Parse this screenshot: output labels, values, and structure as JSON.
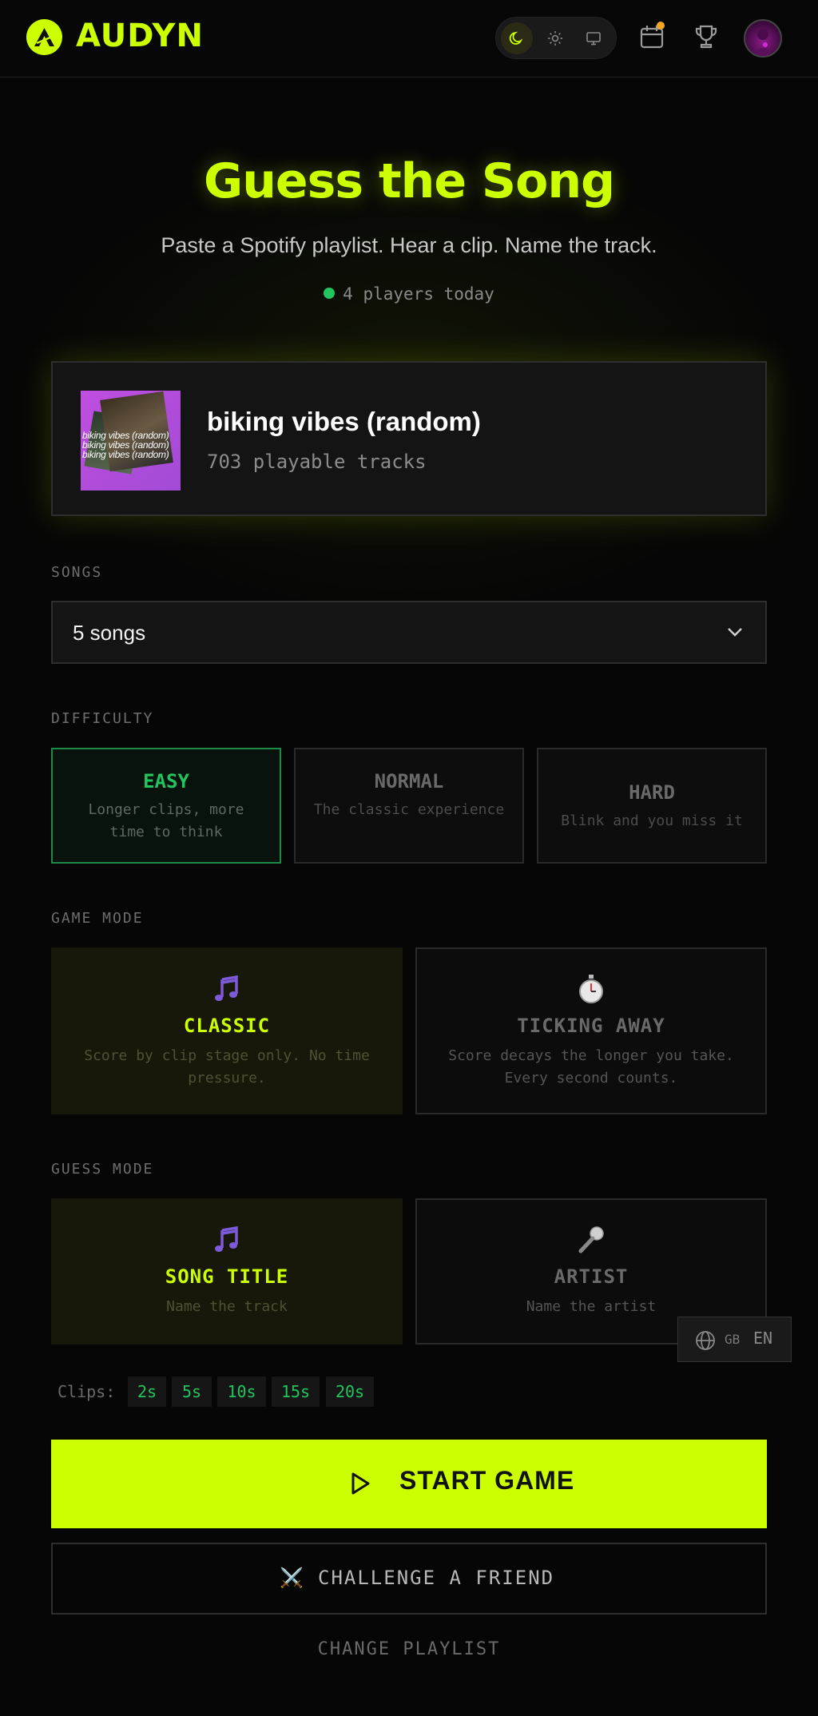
{
  "app": {
    "name": "AUDYN",
    "colors": {
      "accent": "#ccff00",
      "success": "#22c55e",
      "notification": "#f5a623",
      "background": "#060606"
    }
  },
  "header": {
    "theme_options": [
      "dark-mode-icon",
      "light-mode-icon",
      "system-mode-icon"
    ],
    "theme_selected": "dark",
    "icons": [
      "calendar-icon",
      "trophy-icon",
      "avatar"
    ]
  },
  "hero": {
    "title": "Guess the Song",
    "subtitle": "Paste a Spotify playlist. Hear a clip. Name the track.",
    "players_today": "4 players today"
  },
  "playlist": {
    "name": "biking vibes (random)",
    "tracks": "703 playable tracks",
    "cover_text": "biking vibes (random)"
  },
  "songs": {
    "label": "SONGS",
    "value": "5 songs"
  },
  "difficulty": {
    "label": "DIFFICULTY",
    "options": [
      {
        "title": "EASY",
        "desc": "Longer clips, more time to think",
        "selected": true
      },
      {
        "title": "NORMAL",
        "desc": "The classic experience",
        "selected": false
      },
      {
        "title": "HARD",
        "desc": "Blink and you miss it",
        "selected": false
      }
    ]
  },
  "game_mode": {
    "label": "GAME MODE",
    "options": [
      {
        "title": "CLASSIC",
        "desc": "Score by clip stage only. No time pressure.",
        "icon": "music-note-icon",
        "selected": true
      },
      {
        "title": "TICKING AWAY",
        "desc": "Score decays the longer you take. Every second counts.",
        "icon": "stopwatch-icon",
        "selected": false
      }
    ]
  },
  "guess_mode": {
    "label": "GUESS MODE",
    "options": [
      {
        "title": "SONG TITLE",
        "desc": "Name the track",
        "icon": "music-note-icon",
        "selected": true
      },
      {
        "title": "ARTIST",
        "desc": "Name the artist",
        "icon": "microphone-icon",
        "selected": false
      }
    ]
  },
  "language": {
    "code": "GB",
    "label": "EN"
  },
  "clips": {
    "label": "Clips:",
    "values": [
      "2s",
      "5s",
      "10s",
      "15s",
      "20s"
    ]
  },
  "actions": {
    "start": "START GAME",
    "challenge": "CHALLENGE A FRIEND",
    "challenge_icon": "⚔️",
    "change_playlist": "CHANGE PLAYLIST"
  }
}
